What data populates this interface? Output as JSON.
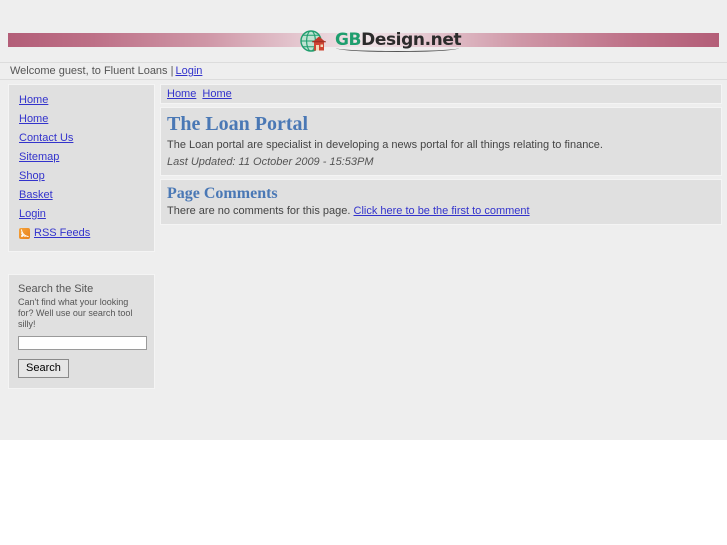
{
  "site": {
    "logo_gb": "GB",
    "logo_rest": "Design.net",
    "logo_icon": "globe-house-icon"
  },
  "welcome": {
    "text": "Welcome guest, to Fluent Loans |",
    "login_label": "Login"
  },
  "sidebar": {
    "menu": [
      {
        "label": "Home",
        "icon": ""
      },
      {
        "label": "Home",
        "icon": ""
      },
      {
        "label": "Contact Us",
        "icon": ""
      },
      {
        "label": "Sitemap",
        "icon": ""
      },
      {
        "label": "Shop",
        "icon": ""
      },
      {
        "label": "Basket",
        "icon": ""
      },
      {
        "label": "Login",
        "icon": ""
      },
      {
        "label": "RSS Feeds",
        "icon": "rss-icon"
      }
    ],
    "search": {
      "title": "Search the Site",
      "blurb": "Can't find what your looking for? Well use our search tool silly!",
      "input_value": "",
      "input_placeholder": "",
      "button_label": "Search"
    }
  },
  "content": {
    "breadcrumbs": [
      "Home",
      "Home"
    ],
    "page_title": "The Loan Portal",
    "intro": "The Loan portal are specialist in developing a news portal for all things relating to finance.",
    "last_updated": "Last Updated: 11 October 2009 - 15:53PM",
    "comments_title": "Page Comments",
    "comments_empty": "There are no comments for this page.",
    "comments_link": "Click here to be the first to comment"
  },
  "colors": {
    "page_bg": "#eeeeee",
    "panel_bg": "#e0e0e0",
    "link": "#3333cc",
    "heading": "#4a78b5",
    "bar_dark": "#b35e78",
    "bar_light": "#f0e5e8",
    "logo_green": "#1f9e6e",
    "rss_orange": "#e8801a"
  }
}
